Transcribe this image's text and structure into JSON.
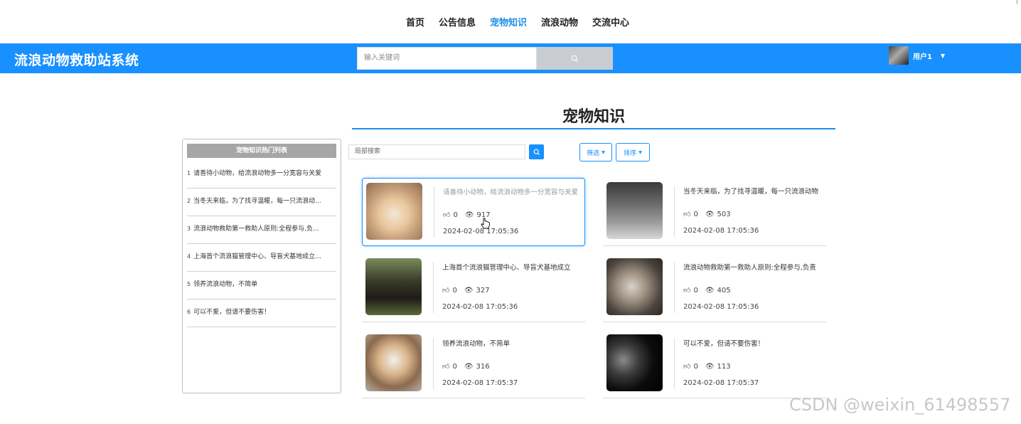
{
  "nav": {
    "items": [
      "首页",
      "公告信息",
      "宠物知识",
      "流浪动物",
      "交流中心"
    ],
    "active_index": 2
  },
  "header": {
    "site_title": "流浪动物救助站系统",
    "search_placeholder": "输入关键词",
    "user_name": "用户1"
  },
  "page": {
    "heading": "宠物知识"
  },
  "sidebar": {
    "title": "宠物知识热门列表",
    "items": [
      {
        "num": "1",
        "text": "请善待小动物，给流浪动物多一分宽容与关爱"
      },
      {
        "num": "2",
        "text": "当冬天来临，为了找寻温暖，每一只流浪动..."
      },
      {
        "num": "3",
        "text": "流浪动物救助第一救助人原则:全程参与,负..."
      },
      {
        "num": "4",
        "text": "上海首个流浪猫管理中心、导盲犬基地成立..."
      },
      {
        "num": "5",
        "text": "领养流浪动物，不简单"
      },
      {
        "num": "6",
        "text": "可以不爱，但请不要伤害！"
      }
    ]
  },
  "toolbar": {
    "local_search_placeholder": "局部搜索",
    "filter_label": "筛选",
    "sort_label": "排序"
  },
  "cards": [
    {
      "title": "请善待小动物，给流浪动物多一分宽容与关爱",
      "likes": "0",
      "views": "917",
      "date": "2024-02-08 17:05:36"
    },
    {
      "title": "当冬天来临，为了找寻温暖，每一只流浪动物",
      "likes": "0",
      "views": "503",
      "date": "2024-02-08 17:05:36"
    },
    {
      "title": "上海首个流浪猫管理中心、导盲犬基地成立",
      "likes": "0",
      "views": "327",
      "date": "2024-02-08 17:05:36"
    },
    {
      "title": "流浪动物救助第一救助人原则:全程参与,负责",
      "likes": "0",
      "views": "405",
      "date": "2024-02-08 17:05:36"
    },
    {
      "title": "领养流浪动物，不简单",
      "likes": "0",
      "views": "316",
      "date": "2024-02-08 17:05:37"
    },
    {
      "title": "可以不爱，但请不要伤害！",
      "likes": "0",
      "views": "113",
      "date": "2024-02-08 17:05:37"
    }
  ],
  "watermark": "CSDN @weixin_61498557",
  "colors": {
    "primary": "#1890ff",
    "active_nav": "#1e8fe8"
  }
}
